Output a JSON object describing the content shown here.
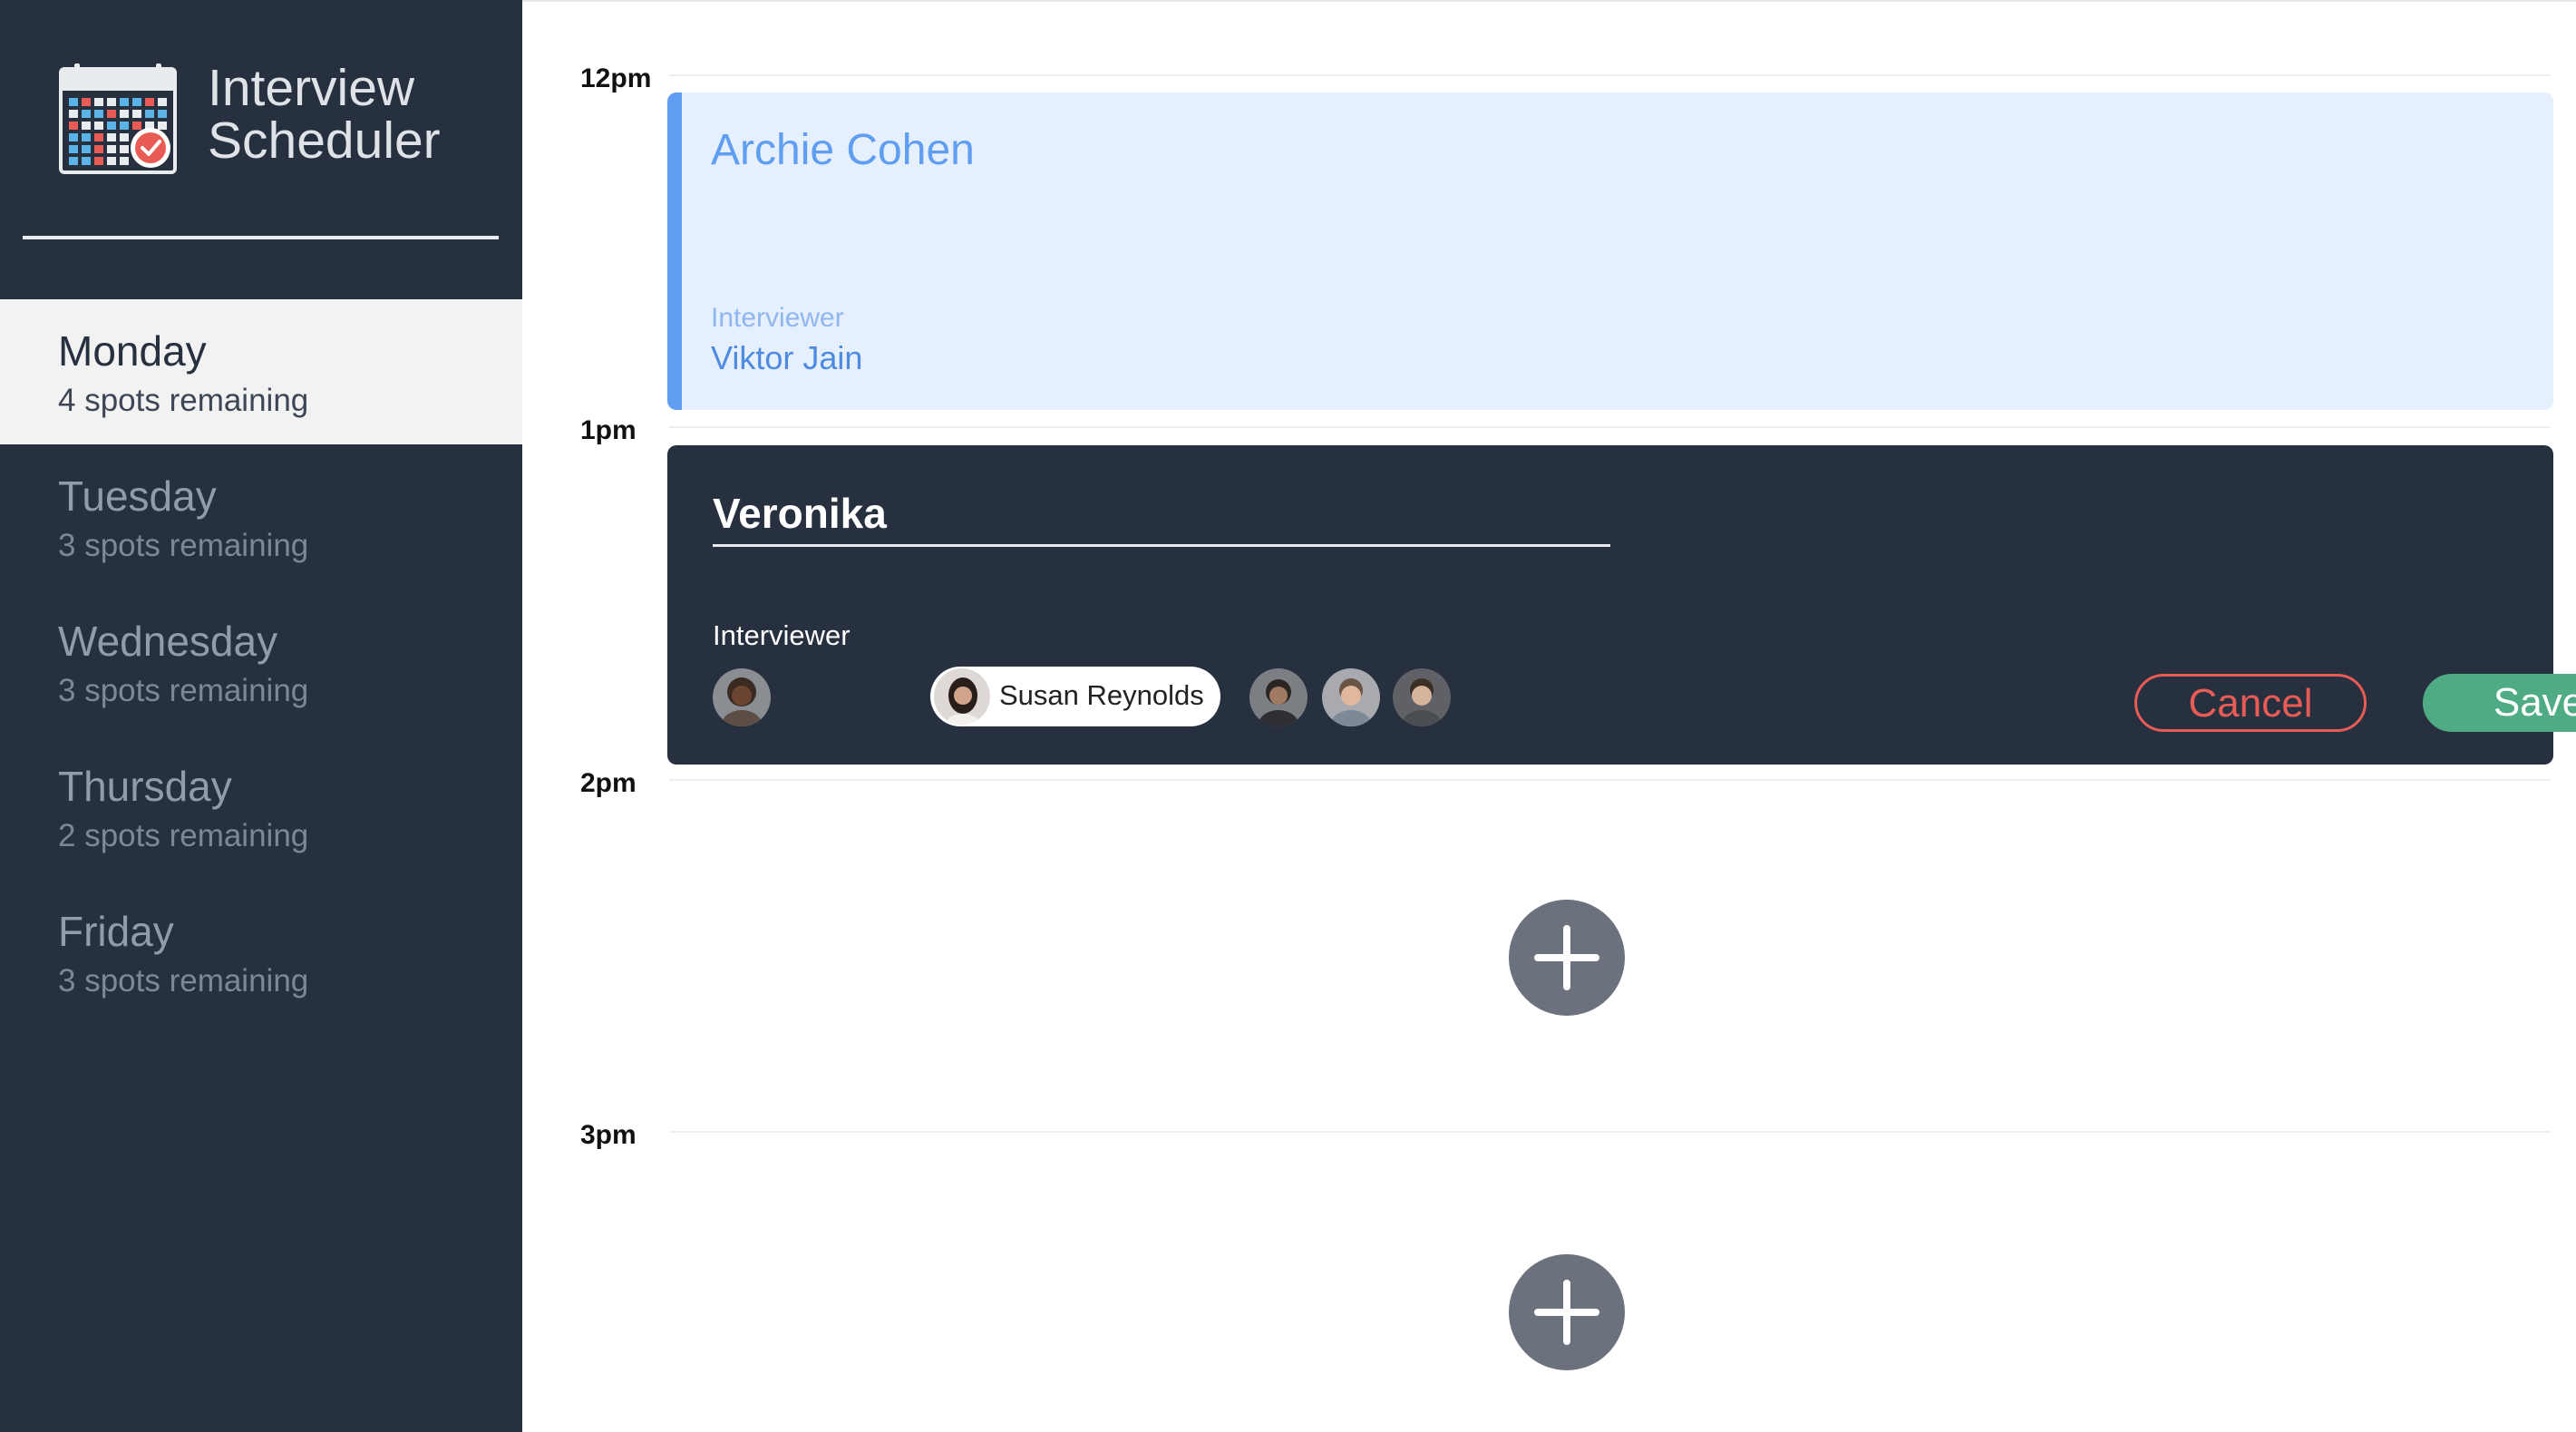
{
  "app": {
    "title_line1": "Interview",
    "title_line2": "Scheduler",
    "logo_icon": "calendar-check-icon"
  },
  "sidebar": {
    "days": [
      {
        "name": "Monday",
        "spots": "4 spots remaining",
        "selected": true
      },
      {
        "name": "Tuesday",
        "spots": "3 spots remaining",
        "selected": false
      },
      {
        "name": "Wednesday",
        "spots": "3 spots remaining",
        "selected": false
      },
      {
        "name": "Thursday",
        "spots": "2 spots remaining",
        "selected": false
      },
      {
        "name": "Friday",
        "spots": "3 spots remaining",
        "selected": false
      }
    ]
  },
  "schedule": {
    "times": [
      "12pm",
      "1pm",
      "2pm",
      "3pm"
    ],
    "booked": {
      "student": "Archie Cohen",
      "interviewer_label": "Interviewer",
      "interviewer": "Viktor Jain"
    },
    "form": {
      "student_value": "Veronika",
      "interviewer_label": "Interviewer",
      "selected_interviewer": "Susan Reynolds",
      "cancel_label": "Cancel",
      "save_label": "Save"
    },
    "empty_slots": [
      {
        "icon": "plus-icon"
      },
      {
        "icon": "plus-icon"
      }
    ]
  },
  "colors": {
    "sidebar_bg": "#27303f",
    "accent_blue": "#5f9ef0",
    "booked_bg": "#e6f0fd",
    "cancel": "#e85c55",
    "save": "#4fab83",
    "add_button": "#6c727d"
  }
}
